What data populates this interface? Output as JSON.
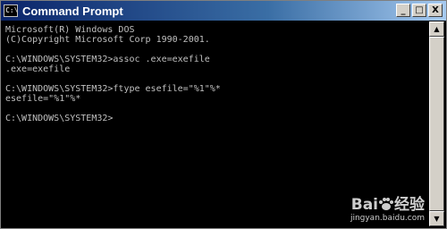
{
  "window": {
    "title": "Command Prompt",
    "icon": "cmd-icon",
    "icon_text": "C:\\",
    "controls": {
      "minimize": "_",
      "maximize": "□",
      "close": "X"
    }
  },
  "console": {
    "lines": [
      "Microsoft(R) Windows DOS",
      "(C)Copyright Microsoft Corp 1990-2001.",
      "",
      "C:\\WINDOWS\\SYSTEM32>assoc .exe=exefile",
      ".exe=exefile",
      "",
      "C:\\WINDOWS\\SYSTEM32>ftype esefile=\"%1\"%*",
      "esefile=\"%1\"%*",
      "",
      "C:\\WINDOWS\\SYSTEM32>"
    ]
  },
  "scrollbar": {
    "up": "▲",
    "down": "▼"
  },
  "watermark": {
    "logo_left": "Bai",
    "logo_right": "经验",
    "url": "jingyan.baidu.com"
  }
}
